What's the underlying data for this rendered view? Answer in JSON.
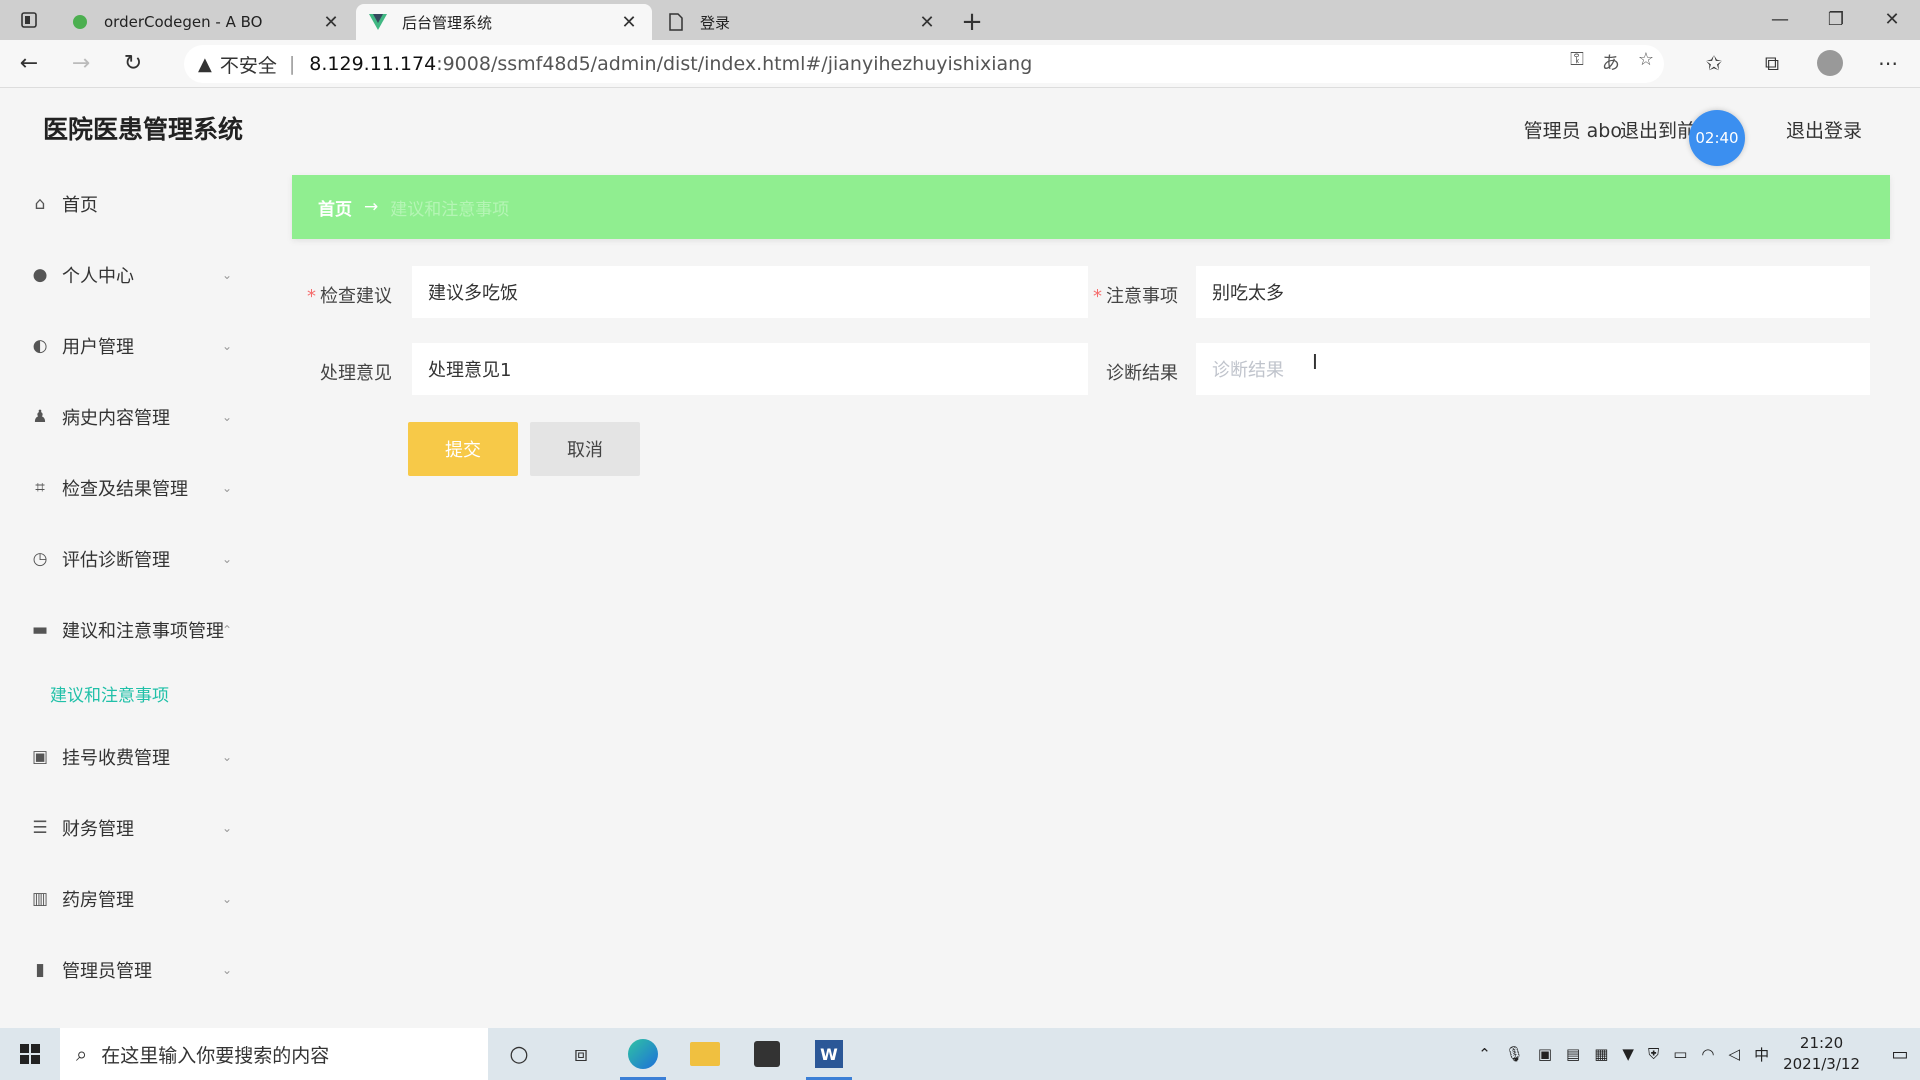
{
  "browser": {
    "tabs": [
      {
        "title": "orderCodegen - A BO",
        "icon": "codegen-icon"
      },
      {
        "title": "后台管理系统",
        "icon": "vue-icon"
      },
      {
        "title": "登录",
        "icon": "page-icon"
      }
    ],
    "new_tab": "+",
    "security_label": "不安全",
    "separator": "|",
    "url_host": "8.129.11.174",
    "url_rest": ":9008/ssmf48d5/admin/dist/index.html#/jianyihezhuyishixiang"
  },
  "header": {
    "title": "医院医患管理系统",
    "user": "管理员 abo",
    "back_label": "退出到前台",
    "logout_label": "退出登录",
    "timer": "02:40"
  },
  "sidebar": {
    "items": [
      {
        "label": "首页",
        "icon": "home-icon"
      },
      {
        "label": "个人中心",
        "icon": "user-icon"
      },
      {
        "label": "用户管理",
        "icon": "mic-icon"
      },
      {
        "label": "病史内容管理",
        "icon": "person-icon"
      },
      {
        "label": "检查及结果管理",
        "icon": "crop-icon"
      },
      {
        "label": "评估诊断管理",
        "icon": "clock-icon"
      },
      {
        "label": "建议和注意事项管理",
        "icon": "briefcase-icon"
      }
    ],
    "sub_item": "建议和注意事项",
    "items_after": [
      {
        "label": "挂号收费管理",
        "icon": "picture-icon"
      },
      {
        "label": "财务管理",
        "icon": "menu-icon"
      },
      {
        "label": "药房管理",
        "icon": "books-icon"
      },
      {
        "label": "管理员管理",
        "icon": "bar-chart-icon"
      }
    ]
  },
  "breadcrumb": {
    "home": "首页",
    "arrow": "→",
    "current": "建议和注意事项"
  },
  "form": {
    "check_advice_label": "检查建议",
    "check_advice_value": "建议多吃饭",
    "precautions_label": "注意事项",
    "precautions_value": "别吃太多",
    "handling_label": "处理意见",
    "handling_value": "处理意见1",
    "diagnosis_label": "诊断结果",
    "diagnosis_placeholder": "诊断结果",
    "submit": "提交",
    "cancel": "取消"
  },
  "taskbar": {
    "search_placeholder": "在这里输入你要搜索的内容",
    "ime": "中",
    "time": "21:20",
    "date": "2021/3/12"
  },
  "colors": {
    "breadcrumb_bg": "#90ee90",
    "submit_bg": "#f7c948",
    "active_sub": "#20c0a8",
    "timer_bg": "#3b8ff0"
  }
}
